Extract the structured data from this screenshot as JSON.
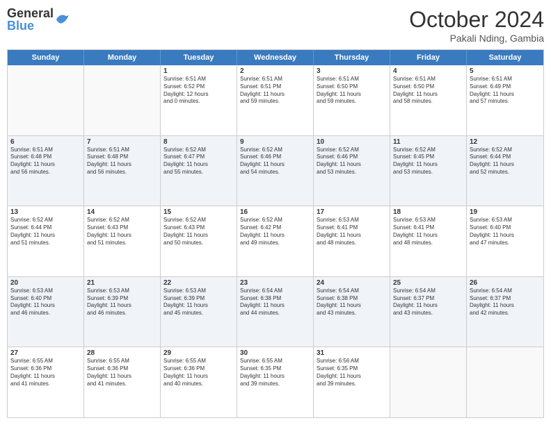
{
  "logo": {
    "general": "General",
    "blue": "Blue"
  },
  "title": "October 2024",
  "location": "Pakali Nding, Gambia",
  "weekdays": [
    "Sunday",
    "Monday",
    "Tuesday",
    "Wednesday",
    "Thursday",
    "Friday",
    "Saturday"
  ],
  "rows": [
    [
      {
        "day": "",
        "lines": []
      },
      {
        "day": "",
        "lines": []
      },
      {
        "day": "1",
        "lines": [
          "Sunrise: 6:51 AM",
          "Sunset: 6:52 PM",
          "Daylight: 12 hours",
          "and 0 minutes."
        ]
      },
      {
        "day": "2",
        "lines": [
          "Sunrise: 6:51 AM",
          "Sunset: 6:51 PM",
          "Daylight: 11 hours",
          "and 59 minutes."
        ]
      },
      {
        "day": "3",
        "lines": [
          "Sunrise: 6:51 AM",
          "Sunset: 6:50 PM",
          "Daylight: 11 hours",
          "and 59 minutes."
        ]
      },
      {
        "day": "4",
        "lines": [
          "Sunrise: 6:51 AM",
          "Sunset: 6:50 PM",
          "Daylight: 11 hours",
          "and 58 minutes."
        ]
      },
      {
        "day": "5",
        "lines": [
          "Sunrise: 6:51 AM",
          "Sunset: 6:49 PM",
          "Daylight: 11 hours",
          "and 57 minutes."
        ]
      }
    ],
    [
      {
        "day": "6",
        "lines": [
          "Sunrise: 6:51 AM",
          "Sunset: 6:48 PM",
          "Daylight: 11 hours",
          "and 56 minutes."
        ]
      },
      {
        "day": "7",
        "lines": [
          "Sunrise: 6:51 AM",
          "Sunset: 6:48 PM",
          "Daylight: 11 hours",
          "and 56 minutes."
        ]
      },
      {
        "day": "8",
        "lines": [
          "Sunrise: 6:52 AM",
          "Sunset: 6:47 PM",
          "Daylight: 11 hours",
          "and 55 minutes."
        ]
      },
      {
        "day": "9",
        "lines": [
          "Sunrise: 6:52 AM",
          "Sunset: 6:46 PM",
          "Daylight: 11 hours",
          "and 54 minutes."
        ]
      },
      {
        "day": "10",
        "lines": [
          "Sunrise: 6:52 AM",
          "Sunset: 6:46 PM",
          "Daylight: 11 hours",
          "and 53 minutes."
        ]
      },
      {
        "day": "11",
        "lines": [
          "Sunrise: 6:52 AM",
          "Sunset: 6:45 PM",
          "Daylight: 11 hours",
          "and 53 minutes."
        ]
      },
      {
        "day": "12",
        "lines": [
          "Sunrise: 6:52 AM",
          "Sunset: 6:44 PM",
          "Daylight: 11 hours",
          "and 52 minutes."
        ]
      }
    ],
    [
      {
        "day": "13",
        "lines": [
          "Sunrise: 6:52 AM",
          "Sunset: 6:44 PM",
          "Daylight: 11 hours",
          "and 51 minutes."
        ]
      },
      {
        "day": "14",
        "lines": [
          "Sunrise: 6:52 AM",
          "Sunset: 6:43 PM",
          "Daylight: 11 hours",
          "and 51 minutes."
        ]
      },
      {
        "day": "15",
        "lines": [
          "Sunrise: 6:52 AM",
          "Sunset: 6:43 PM",
          "Daylight: 11 hours",
          "and 50 minutes."
        ]
      },
      {
        "day": "16",
        "lines": [
          "Sunrise: 6:52 AM",
          "Sunset: 6:42 PM",
          "Daylight: 11 hours",
          "and 49 minutes."
        ]
      },
      {
        "day": "17",
        "lines": [
          "Sunrise: 6:53 AM",
          "Sunset: 6:41 PM",
          "Daylight: 11 hours",
          "and 48 minutes."
        ]
      },
      {
        "day": "18",
        "lines": [
          "Sunrise: 6:53 AM",
          "Sunset: 6:41 PM",
          "Daylight: 11 hours",
          "and 48 minutes."
        ]
      },
      {
        "day": "19",
        "lines": [
          "Sunrise: 6:53 AM",
          "Sunset: 6:40 PM",
          "Daylight: 11 hours",
          "and 47 minutes."
        ]
      }
    ],
    [
      {
        "day": "20",
        "lines": [
          "Sunrise: 6:53 AM",
          "Sunset: 6:40 PM",
          "Daylight: 11 hours",
          "and 46 minutes."
        ]
      },
      {
        "day": "21",
        "lines": [
          "Sunrise: 6:53 AM",
          "Sunset: 6:39 PM",
          "Daylight: 11 hours",
          "and 46 minutes."
        ]
      },
      {
        "day": "22",
        "lines": [
          "Sunrise: 6:53 AM",
          "Sunset: 6:39 PM",
          "Daylight: 11 hours",
          "and 45 minutes."
        ]
      },
      {
        "day": "23",
        "lines": [
          "Sunrise: 6:54 AM",
          "Sunset: 6:38 PM",
          "Daylight: 11 hours",
          "and 44 minutes."
        ]
      },
      {
        "day": "24",
        "lines": [
          "Sunrise: 6:54 AM",
          "Sunset: 6:38 PM",
          "Daylight: 11 hours",
          "and 43 minutes."
        ]
      },
      {
        "day": "25",
        "lines": [
          "Sunrise: 6:54 AM",
          "Sunset: 6:37 PM",
          "Daylight: 11 hours",
          "and 43 minutes."
        ]
      },
      {
        "day": "26",
        "lines": [
          "Sunrise: 6:54 AM",
          "Sunset: 6:37 PM",
          "Daylight: 11 hours",
          "and 42 minutes."
        ]
      }
    ],
    [
      {
        "day": "27",
        "lines": [
          "Sunrise: 6:55 AM",
          "Sunset: 6:36 PM",
          "Daylight: 11 hours",
          "and 41 minutes."
        ]
      },
      {
        "day": "28",
        "lines": [
          "Sunrise: 6:55 AM",
          "Sunset: 6:36 PM",
          "Daylight: 11 hours",
          "and 41 minutes."
        ]
      },
      {
        "day": "29",
        "lines": [
          "Sunrise: 6:55 AM",
          "Sunset: 6:36 PM",
          "Daylight: 11 hours",
          "and 40 minutes."
        ]
      },
      {
        "day": "30",
        "lines": [
          "Sunrise: 6:55 AM",
          "Sunset: 6:35 PM",
          "Daylight: 11 hours",
          "and 39 minutes."
        ]
      },
      {
        "day": "31",
        "lines": [
          "Sunrise: 6:56 AM",
          "Sunset: 6:35 PM",
          "Daylight: 11 hours",
          "and 39 minutes."
        ]
      },
      {
        "day": "",
        "lines": []
      },
      {
        "day": "",
        "lines": []
      }
    ]
  ]
}
